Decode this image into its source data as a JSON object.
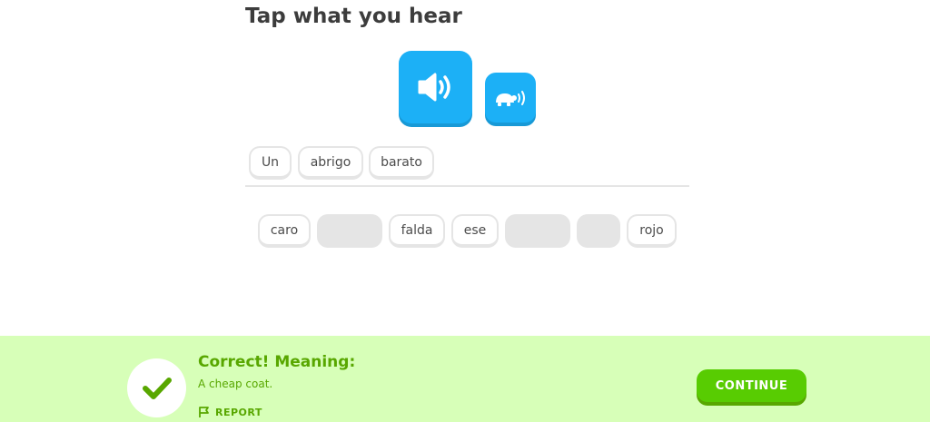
{
  "prompt": {
    "title": "Tap what you hear"
  },
  "audio": {
    "play_icon": "speaker-icon",
    "slow_icon": "turtle-icon",
    "color": "#1cb0f6"
  },
  "answer": {
    "tiles": [
      "Un",
      "abrigo",
      "barato"
    ]
  },
  "bank": {
    "tiles": [
      "caro",
      "",
      "falda",
      "ese",
      "",
      "",
      "rojo"
    ]
  },
  "feedback": {
    "title": "Correct! Meaning:",
    "meaning": "A cheap coat.",
    "report_label": "REPORT",
    "continue_label": "CONTINUE",
    "status_color": "#58cc02",
    "background": "#d7ffb8"
  }
}
